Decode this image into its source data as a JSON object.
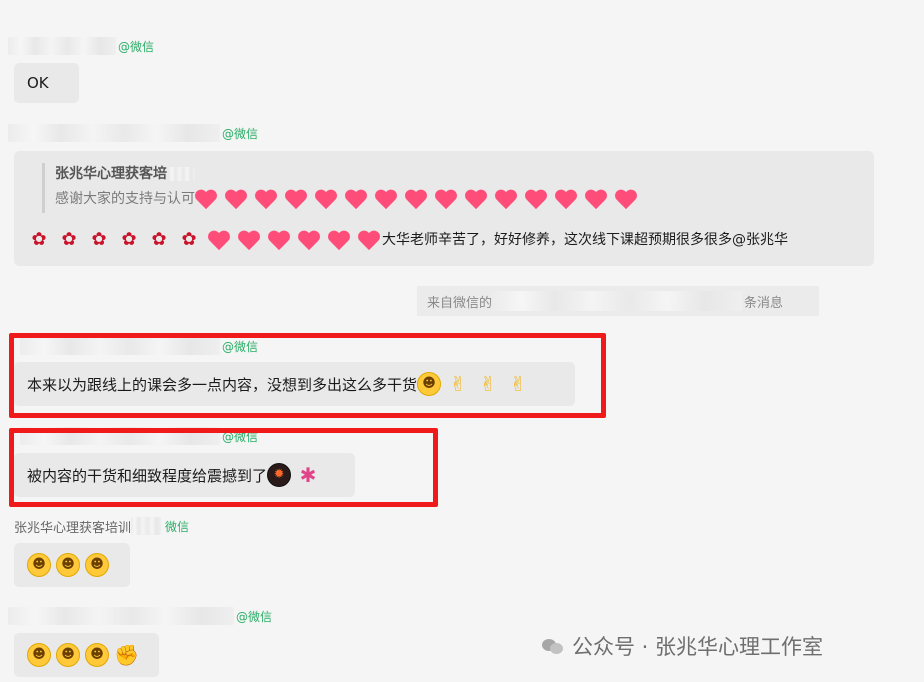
{
  "messages": [
    {
      "sender_suffix": "@微信",
      "text": "OK"
    },
    {
      "sender_suffix": "@微信",
      "quote_title": "张兆华心理获客培",
      "quote_text": "感谢大家的支持与认可",
      "text": "大华老师辛苦了，好好修养，这次线下课超预期很多很多@张兆华"
    },
    {
      "system_prefix": "来自微信的",
      "system_suffix": "条消息"
    },
    {
      "sender_suffix": "@微信",
      "text": "本来以为跟线上的课会多一点内容，没想到多出这么多干货"
    },
    {
      "sender_suffix": "@微信",
      "text": "被内容的干货和细致程度给震撼到了"
    },
    {
      "sender_name": "张兆华心理获客培训",
      "sender_suffix": "微信"
    },
    {
      "sender_suffix": "@微信"
    }
  ],
  "watermark": {
    "text": "公众号 · 张兆华心理工作室"
  },
  "colors": {
    "highlight": "#f11a1a",
    "wechat_green": "#2aae67",
    "bubble": "#e9e9e9",
    "background": "#f5f5f5"
  }
}
